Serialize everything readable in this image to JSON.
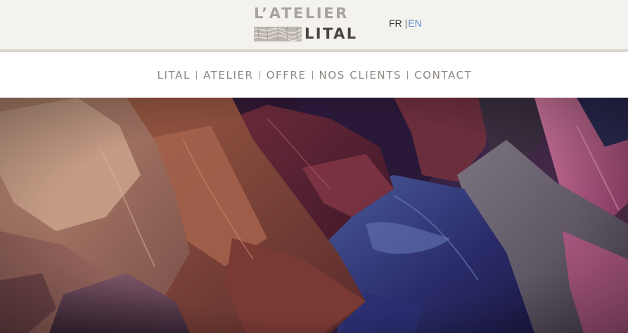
{
  "header": {
    "logo": {
      "line1": "L’ATELIER",
      "line2": "LITAL"
    },
    "language": {
      "fr": "FR",
      "separator": "|",
      "en": "EN",
      "active": "FR"
    }
  },
  "nav": {
    "items": [
      {
        "label": "LITAL"
      },
      {
        "label": "ATELIER"
      },
      {
        "label": "OFFRE"
      },
      {
        "label": "NOS CLIENTS"
      },
      {
        "label": "CONTACT"
      }
    ]
  },
  "hero": {
    "image": "leather-hides-photo"
  },
  "colors": {
    "topbar_bg": "#f4f2ef",
    "topbar_rule": "#dbd5cf",
    "logo_light": "#a8a39f",
    "logo_dark": "#4a4341",
    "nav_text": "#8d8782",
    "lang_link": "#5b8fc8"
  }
}
